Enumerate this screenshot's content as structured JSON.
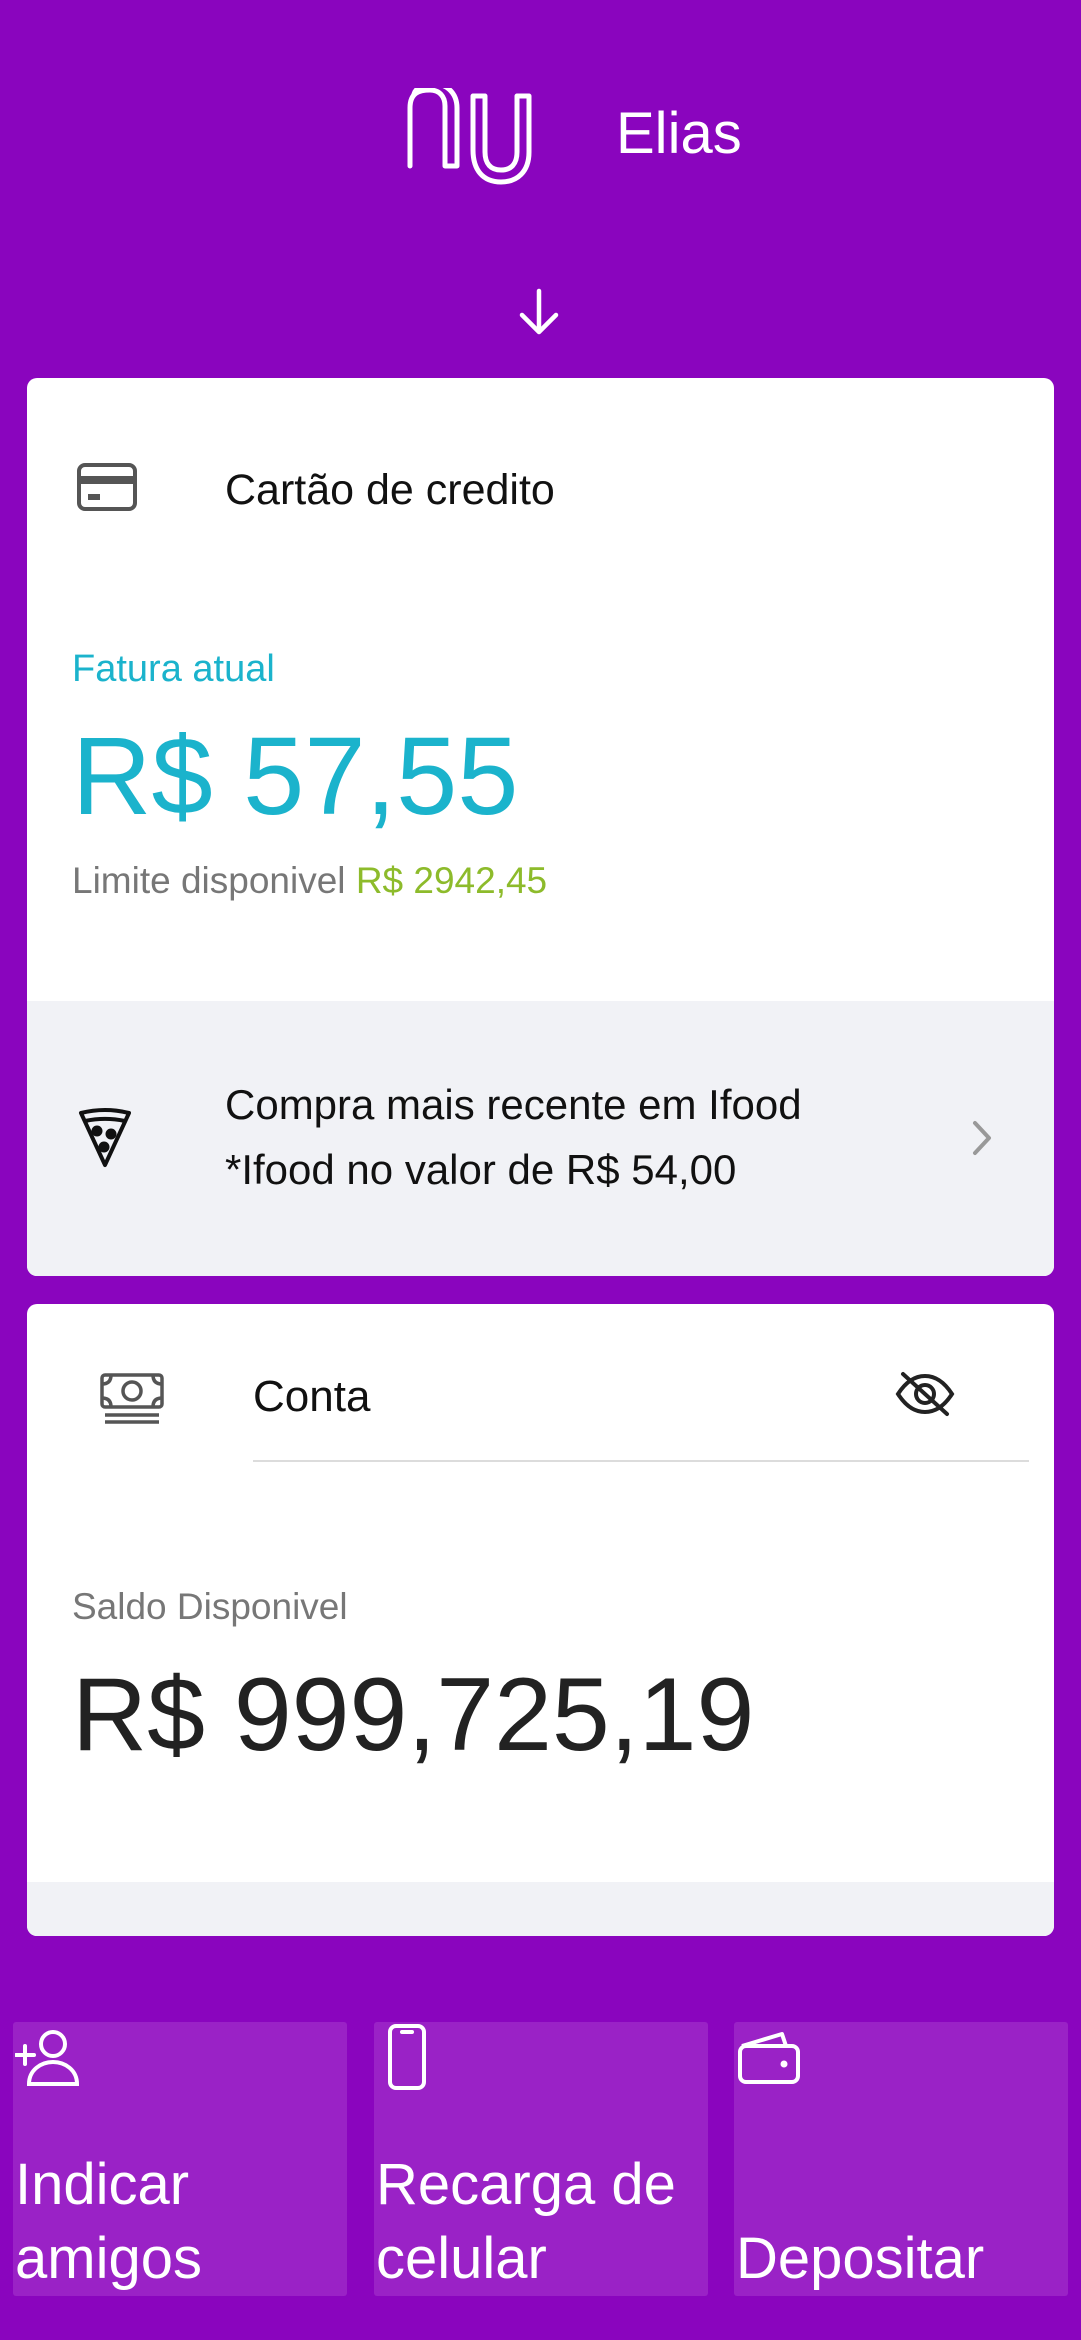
{
  "header": {
    "username": "Elias",
    "logo_icon": "nu-logo",
    "expand_icon": "arrow-down-icon"
  },
  "credit_card": {
    "title": "Cartão de credito",
    "icon": "credit-card-icon",
    "invoice_label": "Fatura atual",
    "invoice_value": "R$ 57,55",
    "limit_label": "Limite disponivel",
    "limit_value": "R$ 2942,45",
    "recent_purchase": {
      "icon": "pizza-icon",
      "line1": "Compra mais recente em Ifood",
      "line2": "*Ifood no valor de R$ 54,00"
    }
  },
  "account": {
    "title": "Conta",
    "icon": "money-icon",
    "visibility_icon": "eye-off-icon",
    "balance_label": "Saldo Disponivel",
    "balance_value": "R$ 999,725,19"
  },
  "shortcuts": [
    {
      "icon": "add-person-icon",
      "line1": "Indicar",
      "line2": "amigos"
    },
    {
      "icon": "phone-icon",
      "line1": "Recarga de",
      "line2": "celular"
    },
    {
      "icon": "wallet-icon",
      "line1": "",
      "line2": "Depositar"
    }
  ],
  "colors": {
    "brand_purple": "#8A05BE",
    "shortcut_purple": "#9A22C6",
    "invoice_blue": "#1BB3CC",
    "limit_green": "#8DBB2B",
    "strip_gray": "#F1F2F6"
  }
}
